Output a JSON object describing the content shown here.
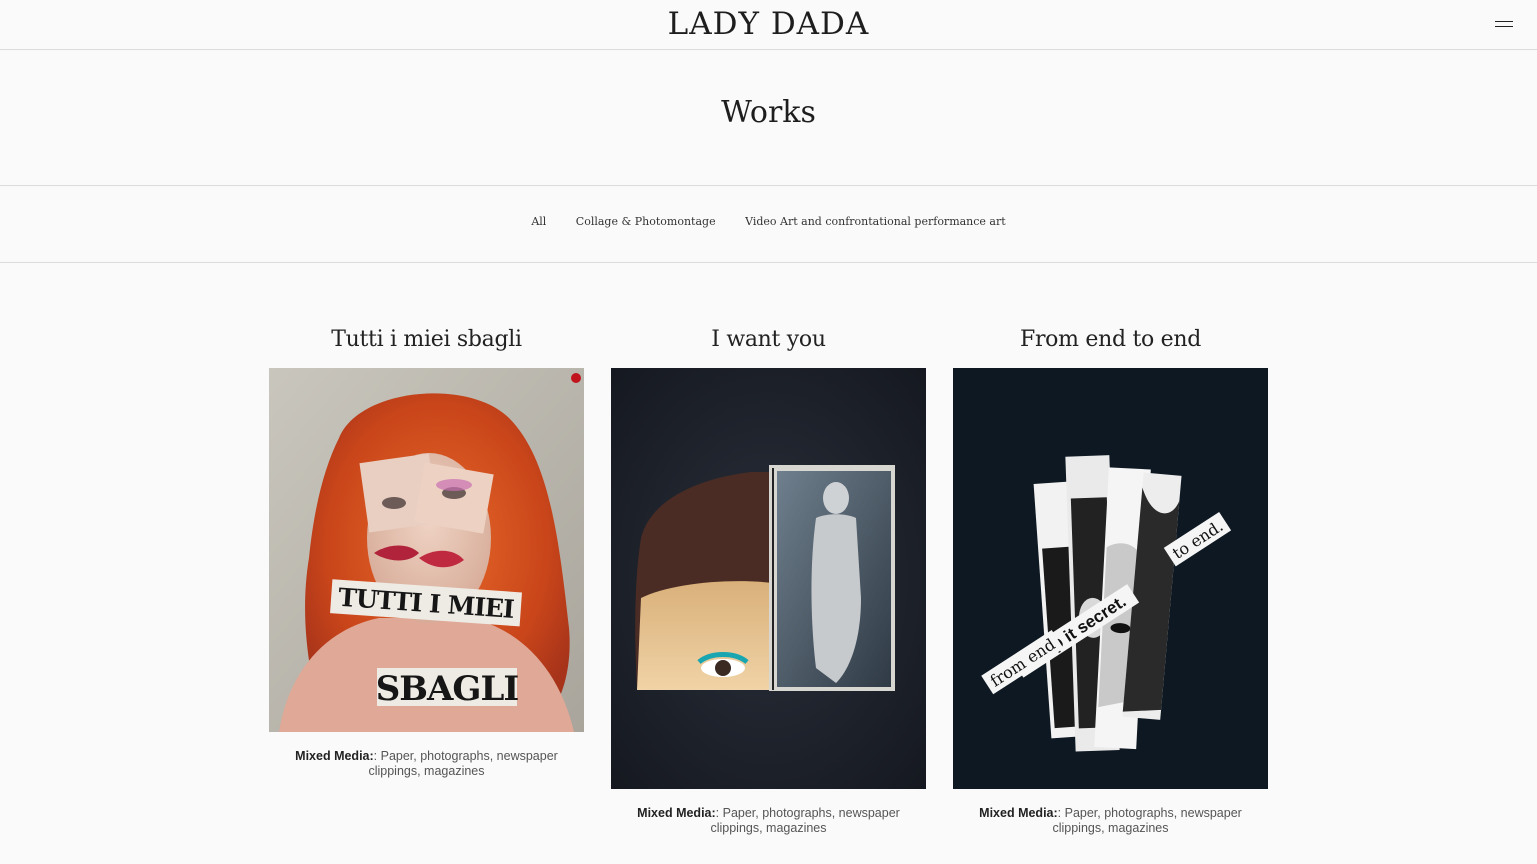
{
  "header": {
    "logo": "LADY DADA",
    "menu_icon": "hamburger-menu-icon"
  },
  "page": {
    "title": "Works"
  },
  "filters": [
    {
      "label": "All"
    },
    {
      "label": "Collage & Photomontage"
    },
    {
      "label": "Video Art and confrontational performance art"
    }
  ],
  "works": [
    {
      "title": "Tutti i miei sbagli",
      "caption_label": "Mixed Media:",
      "caption_text": ": Paper, photographs, newspaper clippings, magazines",
      "overlay_line1": "TUTTI I MIEI",
      "overlay_line2": "SBAGLI"
    },
    {
      "title": "I want you",
      "caption_label": "Mixed Media:",
      "caption_text": ": Paper, photographs, newspaper clippings, magazines"
    },
    {
      "title": "From end to end",
      "caption_label": "Mixed Media:",
      "caption_text": ": Paper, photographs, newspaper clippings, magazines",
      "overlay_line1": "Keep it secret.",
      "overlay_line2": "from end",
      "overlay_line3": "to end."
    }
  ]
}
